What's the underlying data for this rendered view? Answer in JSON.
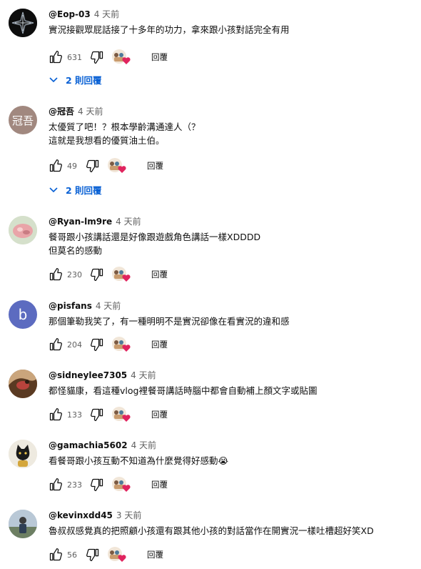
{
  "comments": [
    {
      "author": "@Eop-03",
      "time": "4 天前",
      "text": "實況接觀眾屁話接了十多年的功力，拿來跟小孩對話完全有用",
      "likes": "631",
      "reply": "回覆",
      "replies": "2 則回覆",
      "avatar_bg": "#111111"
    },
    {
      "author": "@冠吾",
      "time": "4 天前",
      "text": "太優質了吧！？根本學齡溝通達人（？\n這就是我想看的優質油土伯。",
      "likes": "49",
      "reply": "回覆",
      "replies": "2 則回覆",
      "avatar_text": "冠吾",
      "avatar_bg": "#a1887f"
    },
    {
      "author": "@Ryan-lm9re",
      "time": "4 天前",
      "text": "餐哥跟小孩講話還是好像跟遊戲角色講話一樣XDDDD\n但莫名的感動",
      "likes": "230",
      "reply": "回覆",
      "avatar_bg": "#d8e3cf"
    },
    {
      "author": "@pisfans",
      "time": "4 天前",
      "text": "那個筆勒我笑了，有一種明明不是實況卻像在看實況的違和感",
      "likes": "204",
      "reply": "回覆",
      "avatar_text": "b",
      "avatar_bg": "#5c6bc0"
    },
    {
      "author": "@sidneylee7305",
      "time": "4 天前",
      "text": "都怪貓康，看這種vlog裡餐哥講話時腦中都會自動補上顏文字或貼圖",
      "likes": "133",
      "reply": "回覆",
      "avatar_bg": "#7a5a3a"
    },
    {
      "author": "@gamachia5602",
      "time": "4 天前",
      "text": "看餐哥跟小孩互動不知道為什麼覺得好感動😭",
      "likes": "233",
      "reply": "回覆",
      "avatar_bg": "#e9e4d6"
    },
    {
      "author": "@kevinxdd45",
      "time": "3 天前",
      "text": "魯叔叔感覺真的把照顧小孩還有跟其他小孩的對話當作在開實況一樣吐槽超好笑XD",
      "likes": "56",
      "reply": "回覆",
      "avatar_bg": "#8fa4b8"
    }
  ],
  "icons": {
    "like": "thumb-up-icon",
    "dislike": "thumb-down-icon",
    "heart": "creator-heart-icon",
    "expand": "chevron-down-icon"
  },
  "colors": {
    "link": "#065fd4",
    "heart": "#e0245e",
    "meta": "#606060"
  }
}
